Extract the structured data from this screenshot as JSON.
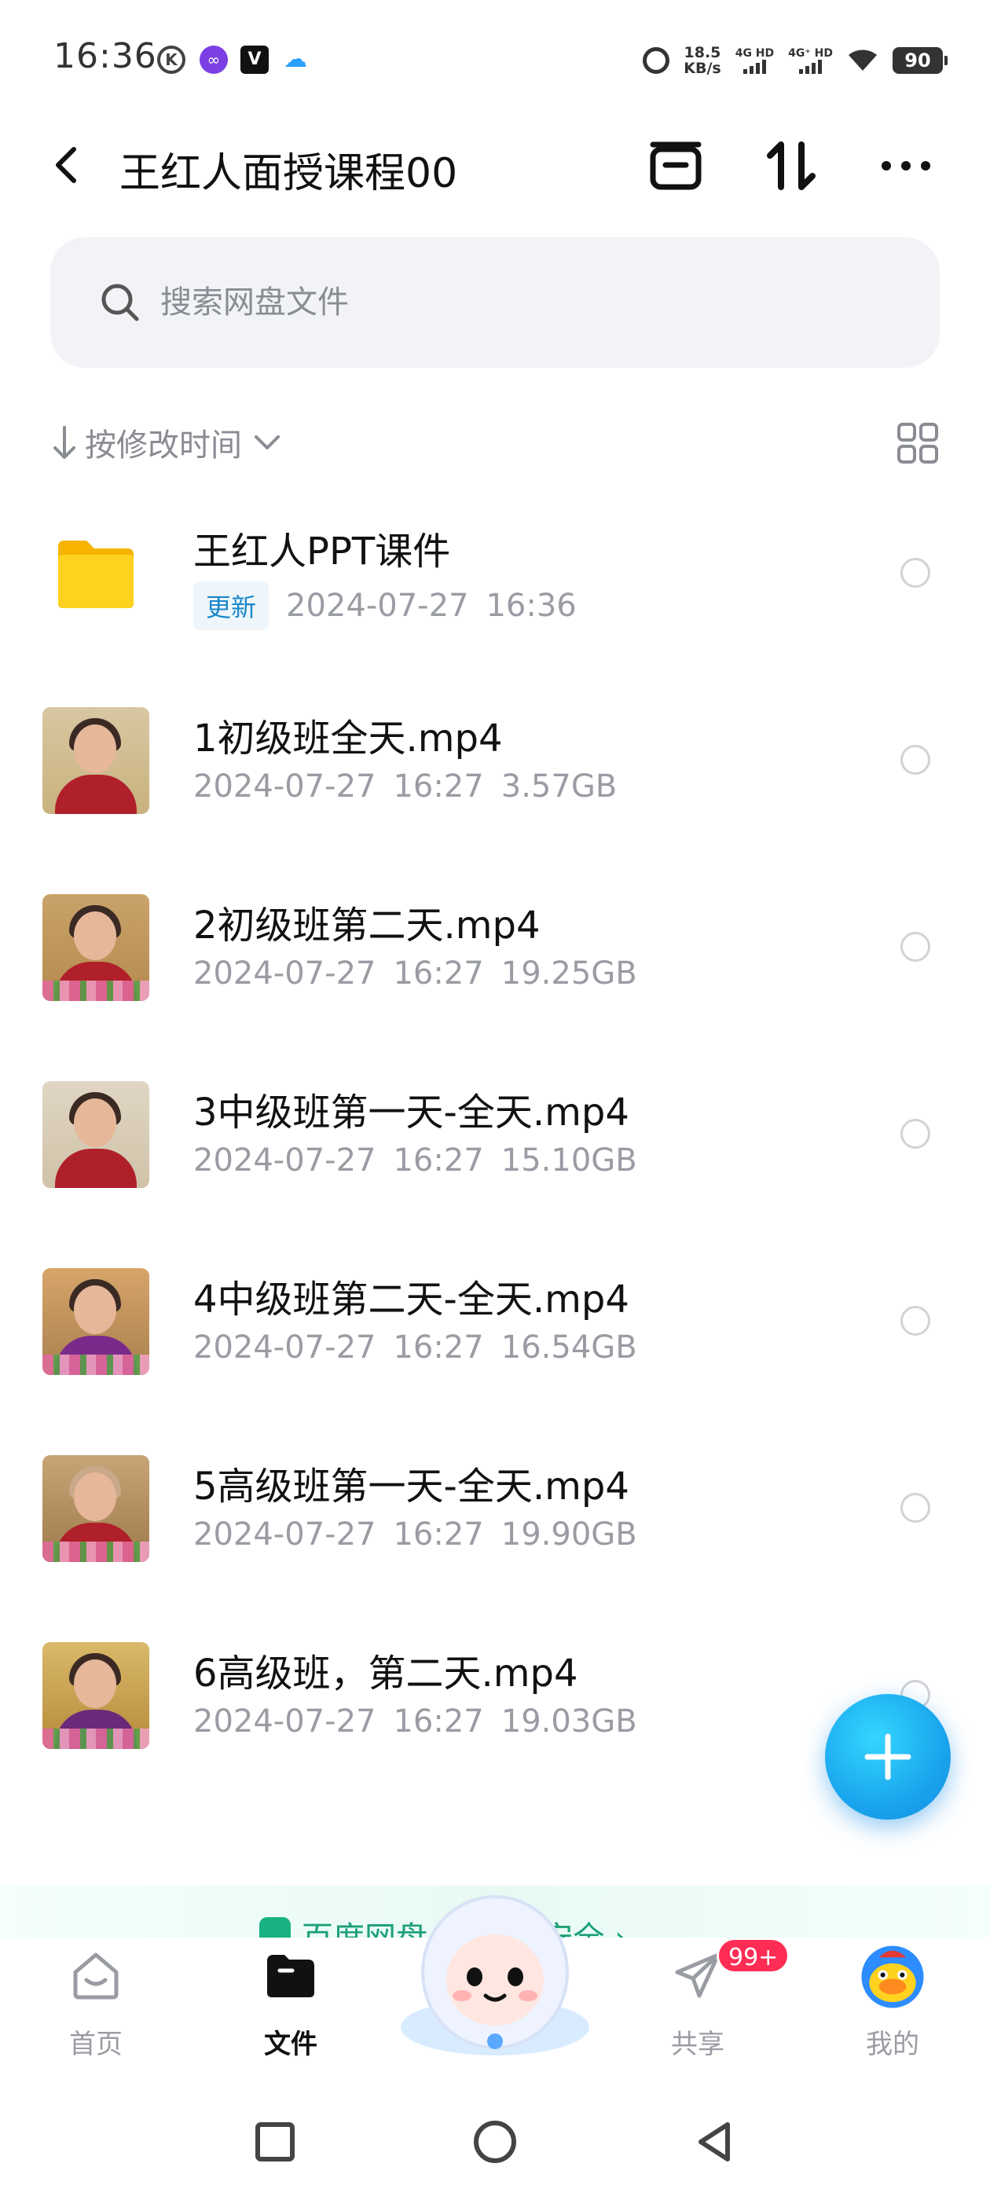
{
  "status_bar": {
    "time": "16:36",
    "icons": [
      "k-badge-icon",
      "link-app-icon",
      "v-app-icon",
      "cloud-app-icon"
    ],
    "network_speed_value": "18.5",
    "network_speed_unit": "KB/s",
    "sim1_label": "4G HD",
    "sim2_label": "4G⁺ HD",
    "battery": "90"
  },
  "header": {
    "title": "王红人面授课程00"
  },
  "search": {
    "placeholder": "搜索网盘文件"
  },
  "sort": {
    "label": "按修改时间"
  },
  "files": [
    {
      "type": "folder",
      "name": "王红人PPT课件",
      "badge": "更新",
      "date": "2024-07-27",
      "time": "16:36",
      "size": ""
    },
    {
      "type": "video",
      "name": "1初级班全天.mp4",
      "date": "2024-07-27",
      "time": "16:27",
      "size": "3.57GB"
    },
    {
      "type": "video",
      "name": "2初级班第二天.mp4",
      "date": "2024-07-27",
      "time": "16:27",
      "size": "19.25GB"
    },
    {
      "type": "video",
      "name": "3中级班第一天-全天.mp4",
      "date": "2024-07-27",
      "time": "16:27",
      "size": "15.10GB"
    },
    {
      "type": "video",
      "name": "4中级班第二天-全天.mp4",
      "date": "2024-07-27",
      "time": "16:27",
      "size": "16.54GB"
    },
    {
      "type": "video",
      "name": "5高级班第一天-全天.mp4",
      "date": "2024-07-27",
      "time": "16:27",
      "size": "19.90GB"
    },
    {
      "type": "video",
      "name": "6高级班，第二天.mp4",
      "date": "2024-07-27",
      "time": "16:27",
      "size": "19.03GB"
    }
  ],
  "promo": {
    "text": "百度网盘 … 数据安全 ›"
  },
  "bottom_nav": {
    "items": [
      {
        "label": "首页",
        "icon": "home-icon",
        "active": false
      },
      {
        "label": "文件",
        "icon": "folder-icon",
        "active": true
      },
      {
        "label": "共享",
        "icon": "paper-plane-icon",
        "active": false,
        "badge": "99+"
      },
      {
        "label": "我的",
        "icon": "avatar-icon",
        "active": false
      }
    ]
  },
  "colors": {
    "accent": "#1aa6ee",
    "badge": "#ff2d55",
    "update_badge_text": "#1a87c9",
    "muted_text": "#9a9ca3",
    "folder": "#ffc824",
    "promo": "#1ba079"
  }
}
